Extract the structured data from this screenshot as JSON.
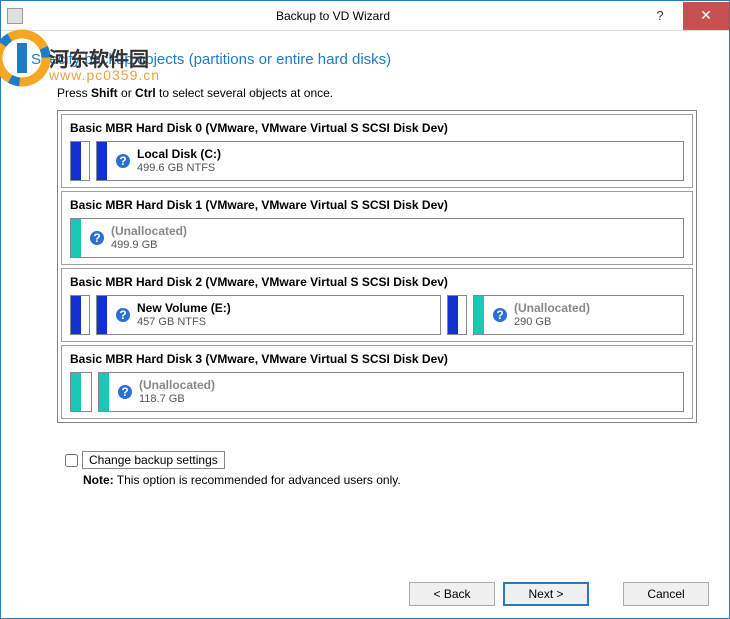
{
  "window": {
    "title": "Backup to VD Wizard"
  },
  "heading": "Specify backup objects (partitions or entire hard disks)",
  "instruction": {
    "pre": "Press ",
    "k1": "Shift",
    "mid": " or ",
    "k2": "Ctrl",
    "post": " to select several objects at once."
  },
  "disks": {
    "d0": {
      "title": "Basic MBR Hard Disk 0 (VMware, VMware Virtual S SCSI Disk Dev)",
      "p2": {
        "name": "Local Disk (C:)",
        "size": "499.6 GB NTFS"
      }
    },
    "d1": {
      "title": "Basic MBR Hard Disk 1 (VMware, VMware Virtual S SCSI Disk Dev)",
      "p1": {
        "name": "(Unallocated)",
        "size": "499.9 GB"
      }
    },
    "d2": {
      "title": "Basic MBR Hard Disk 2 (VMware, VMware Virtual S SCSI Disk Dev)",
      "p2": {
        "name": "New Volume (E:)",
        "size": "457 GB NTFS"
      },
      "p3": {
        "name": "(Unallocated)",
        "size": "290 GB"
      }
    },
    "d3": {
      "title": "Basic MBR Hard Disk 3 (VMware, VMware Virtual S SCSI Disk Dev)",
      "p2": {
        "name": "(Unallocated)",
        "size": "118.7 GB"
      }
    }
  },
  "advanced": {
    "label": "Change backup settings"
  },
  "note": {
    "b": "Note:",
    "t": " This option is recommended for advanced users only."
  },
  "buttons": {
    "back": "< Back",
    "next": "Next >",
    "cancel": "Cancel"
  },
  "watermark": {
    "text": "河东软件园",
    "url": "www.pc0359.cn"
  }
}
